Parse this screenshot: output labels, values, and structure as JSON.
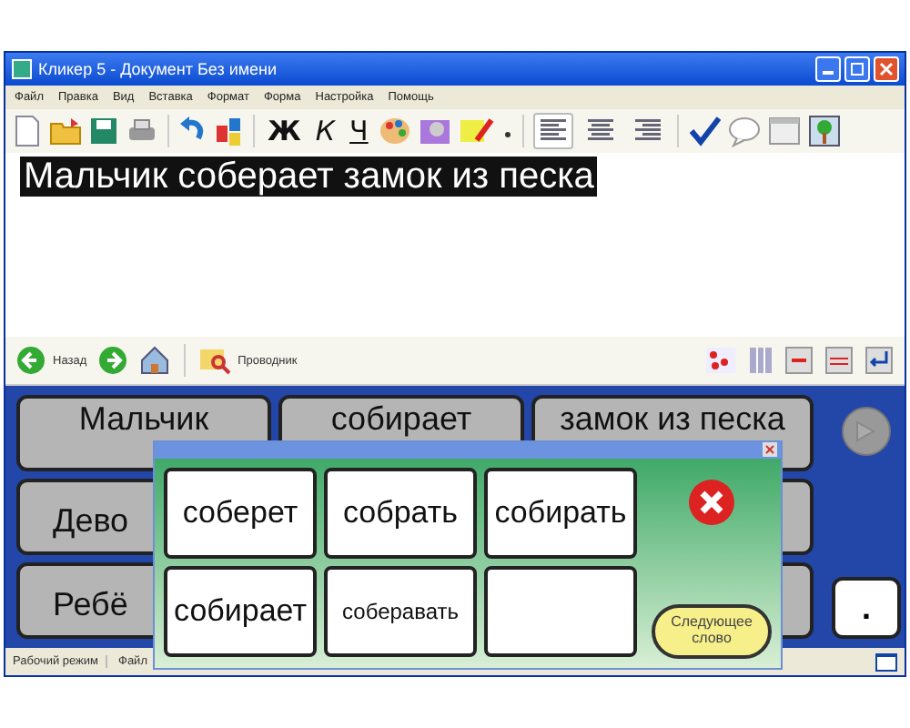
{
  "window": {
    "title": "Кликер 5 - Документ Без имени"
  },
  "menu": [
    "Файл",
    "Правка",
    "Вид",
    "Вставка",
    "Формат",
    "Форма",
    "Настройка",
    "Помощь"
  ],
  "toolbar": {
    "format_buttons": [
      "Ж",
      "К",
      "Ч"
    ],
    "align_buttons": [
      {
        "selected": true
      },
      {
        "selected": false
      },
      {
        "selected": false
      }
    ]
  },
  "document": {
    "text": "Мальчик соберает замок из песка"
  },
  "nav": {
    "back": "Назад",
    "explorer": "Проводник"
  },
  "grid": {
    "rows": [
      [
        "Мальчик",
        "собирает",
        "замок из песка"
      ],
      [
        "Дево"
      ],
      [
        "Ребё"
      ]
    ],
    "end_cell": "."
  },
  "popup": {
    "words": [
      "соберет",
      "собрать",
      "собирать",
      "собирает",
      "соберавать"
    ],
    "next_button": "Следующее слово"
  },
  "status_bar": [
    "Рабочий режим",
    "Файл"
  ]
}
